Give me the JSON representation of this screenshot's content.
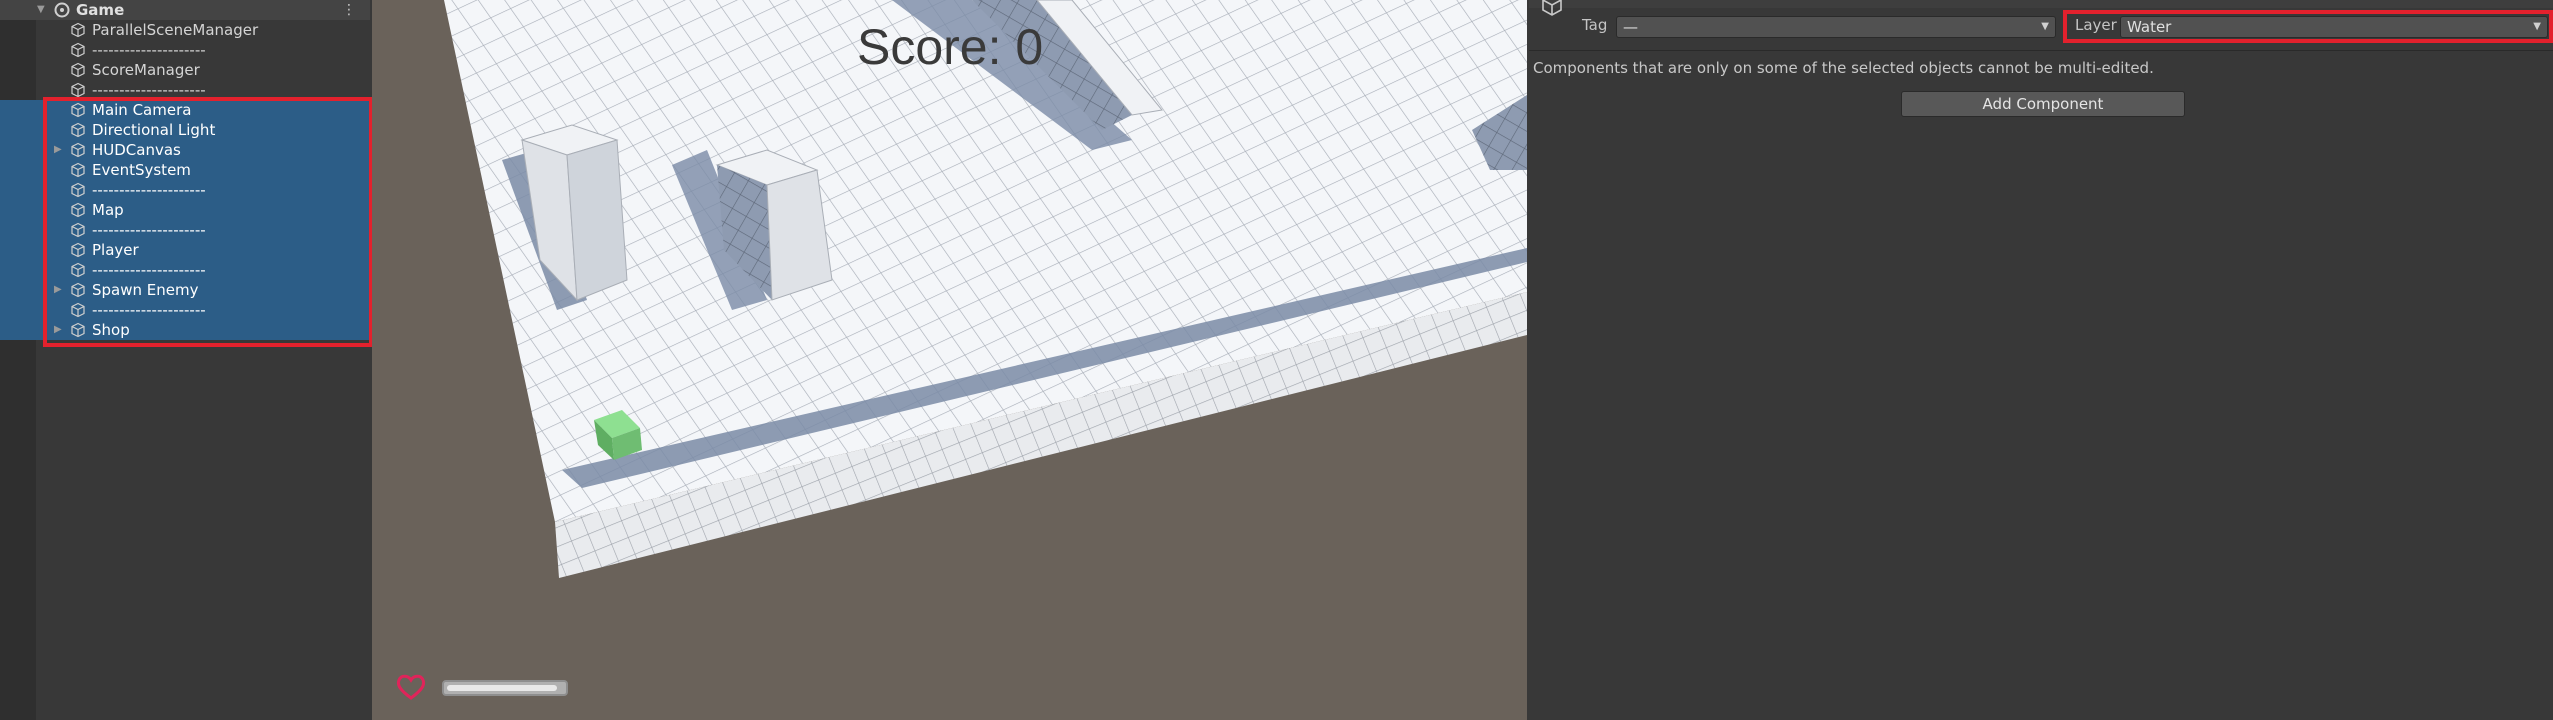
{
  "hierarchy": {
    "scene_name": "Game",
    "items": [
      {
        "label": "ParallelSceneManager",
        "selected": false,
        "foldout": false
      },
      {
        "label": "---------------------",
        "selected": false,
        "foldout": false
      },
      {
        "label": "ScoreManager",
        "selected": false,
        "foldout": false
      },
      {
        "label": "---------------------",
        "selected": false,
        "foldout": false
      },
      {
        "label": "Main Camera",
        "selected": true,
        "foldout": false
      },
      {
        "label": "Directional Light",
        "selected": true,
        "foldout": false
      },
      {
        "label": "HUDCanvas",
        "selected": true,
        "foldout": true
      },
      {
        "label": "EventSystem",
        "selected": true,
        "foldout": false
      },
      {
        "label": "---------------------",
        "selected": true,
        "foldout": false
      },
      {
        "label": "Map",
        "selected": true,
        "foldout": false
      },
      {
        "label": "---------------------",
        "selected": true,
        "foldout": false
      },
      {
        "label": "Player",
        "selected": true,
        "foldout": false
      },
      {
        "label": "---------------------",
        "selected": true,
        "foldout": false
      },
      {
        "label": "Spawn Enemy",
        "selected": true,
        "foldout": true
      },
      {
        "label": "---------------------",
        "selected": true,
        "foldout": false
      },
      {
        "label": "Shop",
        "selected": true,
        "foldout": true
      }
    ],
    "icons": {
      "scene": "unity-scene-icon",
      "gameobject": "cube-icon",
      "menu": "kebab-menu-icon"
    }
  },
  "game_view": {
    "score_text": "Score: 0",
    "health_fraction": 0.95,
    "colors": {
      "background": "#6a625a",
      "floor": "#f4f6f9",
      "shadow": "#7a8ba6",
      "player": "#7ccf7f",
      "heart": "#e0245a"
    }
  },
  "inspector": {
    "tag_label": "Tag",
    "tag_value": "—",
    "layer_label": "Layer",
    "layer_value": "Water",
    "multi_edit_message": "Components that are only on some of the selected objects cannot be multi-edited.",
    "add_component_label": "Add Component"
  },
  "highlight_color": "#e3212d"
}
